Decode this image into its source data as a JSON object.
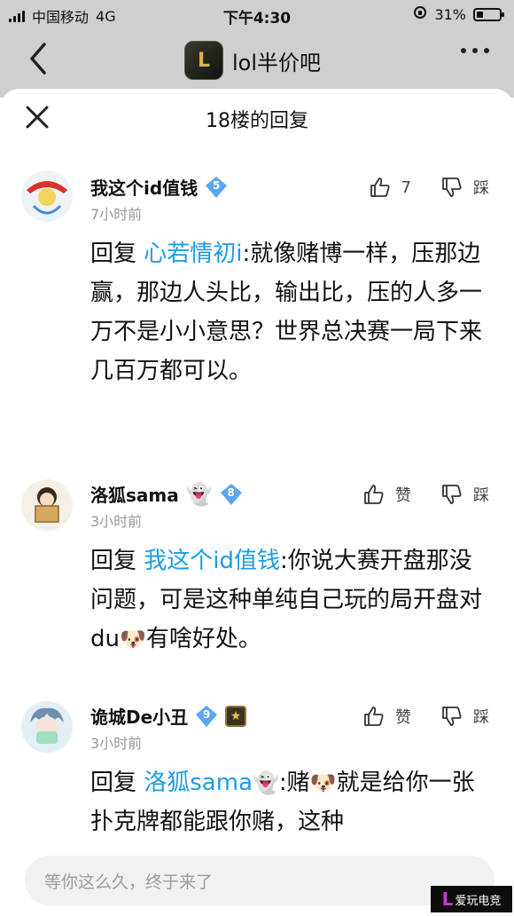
{
  "status_bar": {
    "carrier": "中国移动",
    "network": "4G",
    "time": "下午4:30",
    "battery": "31%",
    "battery_level": 0.31
  },
  "nav": {
    "logo_text": "L",
    "title": "lol半价吧"
  },
  "sheet": {
    "title": "18楼的回复"
  },
  "comments": [
    {
      "username": "我这个id值钱",
      "level": "5",
      "level_color": "#5aa6f0",
      "time": "7小时前",
      "like_label": "7",
      "dislike_label": "踩",
      "reply_prefix": "回复 ",
      "mention": "心若情初i",
      "text": ":就像赌博一样，压那边赢，那边人头比，输出比，压的人多一万不是小小意思？世界总决赛一局下来几百万都可以。"
    },
    {
      "username": "洛狐sama",
      "username_emoji": "👻",
      "level": "8",
      "level_color": "#5aa6f0",
      "time": "3小时前",
      "like_label": "赞",
      "dislike_label": "踩",
      "reply_prefix": "回复 ",
      "mention": "我这个id值钱",
      "text": ":你说大赛开盘那没问题，可是这种单纯自己玩的局开盘对du",
      "text_emoji": "🐶",
      "text_tail": "有啥好处。"
    },
    {
      "username": "诡城De小丑",
      "level": "9",
      "level_color": "#5aa6f0",
      "time": "3小时前",
      "like_label": "赞",
      "dislike_label": "踩",
      "reply_prefix": "回复 ",
      "mention": "洛狐sama",
      "mention_emoji": "👻",
      "text": ":赌",
      "text_emoji": "🐶",
      "text_tail": "就是给你一张扑克牌都能跟你赌，这种"
    }
  ],
  "input": {
    "placeholder": "等你这么久，终于来了"
  },
  "watermark": {
    "text": "爱玩电竞"
  }
}
